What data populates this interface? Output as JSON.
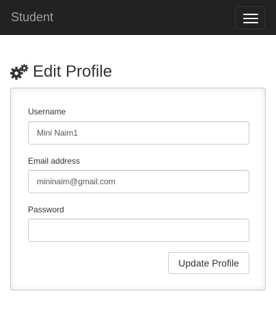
{
  "navbar": {
    "brand": "Student",
    "toggle_icon": "hamburger-icon"
  },
  "page": {
    "heading_icon": "gears-icon",
    "title": "Edit Profile"
  },
  "form": {
    "username_label": "Username",
    "username_value": "Mini Naim1",
    "email_label": "Email address",
    "email_value": "mininaim@gmail.com",
    "password_label": "Password",
    "password_value": "",
    "submit_label": "Update Profile"
  },
  "colors": {
    "navbar_bg": "#222222",
    "brand_text": "#9d9d9d",
    "border": "#cccccc"
  }
}
